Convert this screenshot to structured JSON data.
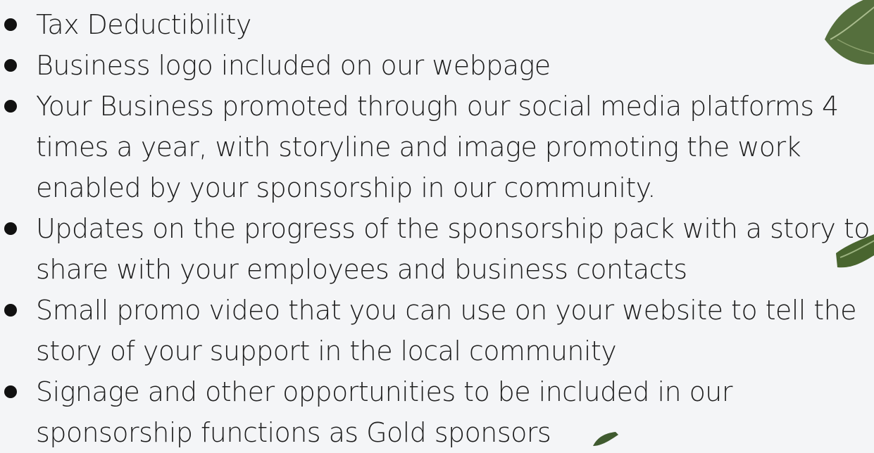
{
  "benefits": [
    {
      "text": "Tax Deductibility"
    },
    {
      "text": "Business logo included on our webpage"
    },
    {
      "text": "Your Business promoted through our social media platforms 4 times a year, with storyline and image promoting the work enabled by your sponsorship in our community."
    },
    {
      "text": "Updates on the progress of the sponsorship pack with a story to share with your employees and business contacts"
    },
    {
      "text": "Small promo video that you can use on your website to tell the story of your support in the local community"
    },
    {
      "text": "Signage and other opportunities to be included in our sponsorship functions as Gold sponsors"
    }
  ],
  "colors": {
    "background": "#f4f5f7",
    "text": "#1e1e1e",
    "bullet": "#111111",
    "leaf_dark": "#3f5a2f",
    "leaf_light": "#7f9b63"
  },
  "icons": {
    "bullet": "bullet-dot-icon",
    "leaves": "leaf-icon"
  }
}
